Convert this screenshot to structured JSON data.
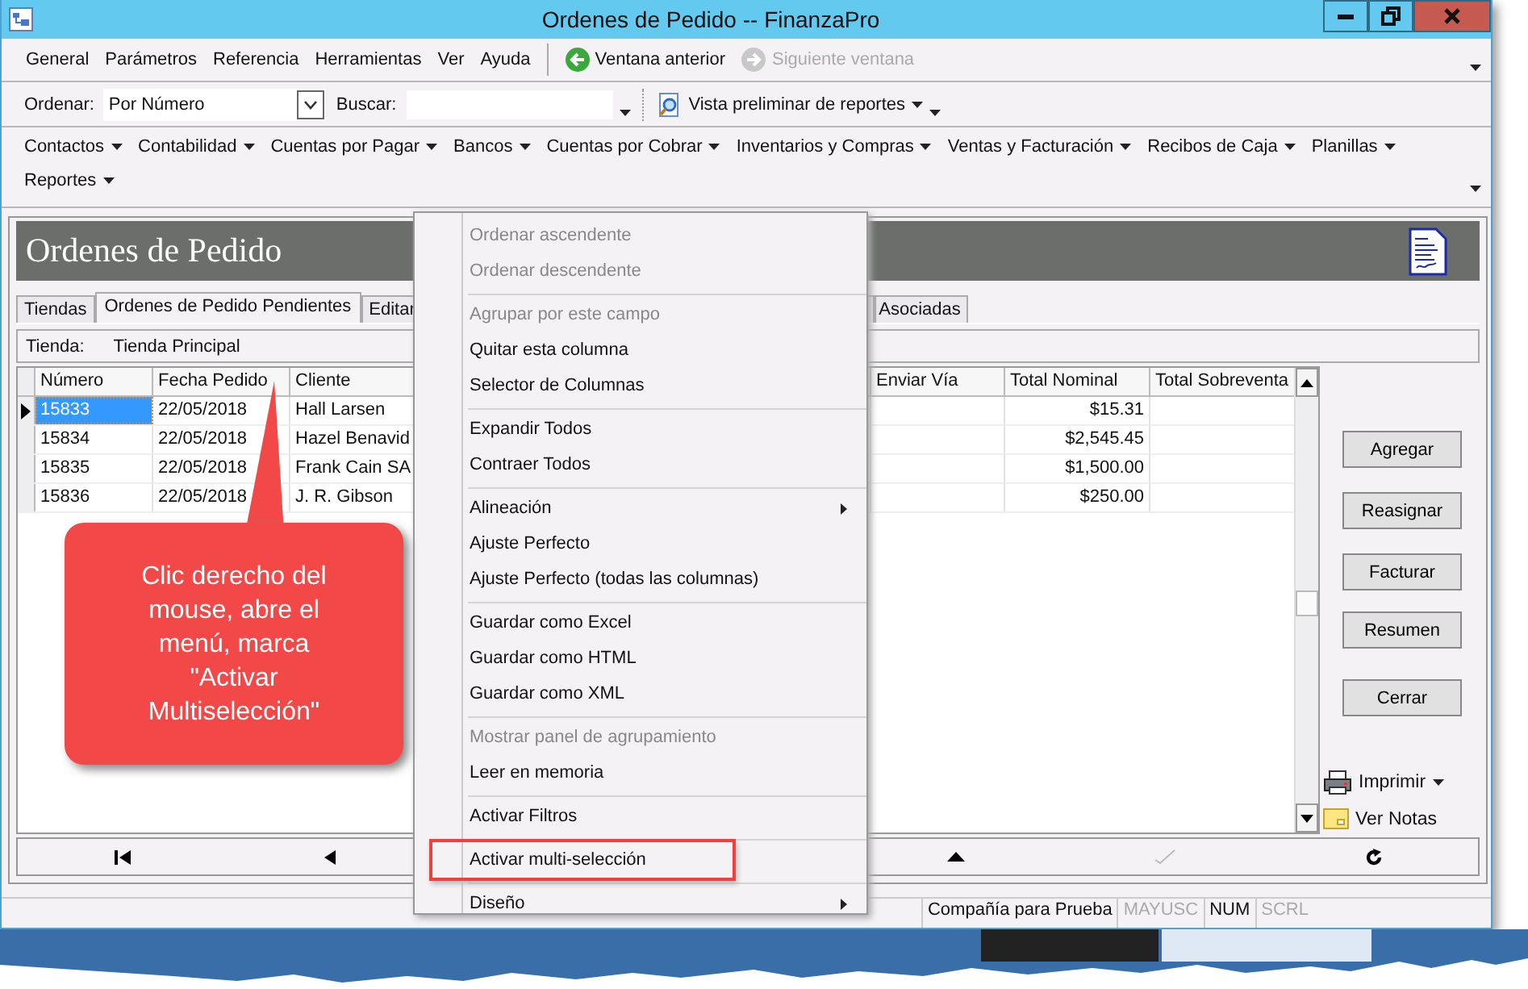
{
  "window": {
    "title": "Ordenes de Pedido -- FinanzaPro"
  },
  "menu_bar": {
    "items": [
      {
        "label": "General"
      },
      {
        "label": "Parámetros"
      },
      {
        "label": "Referencia"
      },
      {
        "label": "Herramientas"
      },
      {
        "label": "Ver"
      },
      {
        "label": "Ayuda"
      }
    ],
    "history": [
      {
        "kind": "back",
        "label": "Ventana anterior",
        "disabled": false
      },
      {
        "kind": "forward",
        "label": "Siguiente ventana",
        "disabled": true
      }
    ]
  },
  "toolbar": {
    "sort_label": "Ordenar:",
    "sort_value": "Por Número",
    "search_label": "Buscar:",
    "report_preview": "Vista preliminar de reportes"
  },
  "modules": [
    {
      "label": "Contactos"
    },
    {
      "label": "Contabilidad"
    },
    {
      "label": "Cuentas por Pagar"
    },
    {
      "label": "Bancos"
    },
    {
      "label": "Cuentas por Cobrar"
    },
    {
      "label": "Inventarios y Compras"
    },
    {
      "label": "Ventas y Facturación"
    },
    {
      "label": "Recibos de Caja"
    },
    {
      "label": "Planillas"
    },
    {
      "label": "Reportes"
    }
  ],
  "form": {
    "heading": "Ordenes de Pedido",
    "tabs": [
      {
        "label": "Tiendas",
        "selected": false
      },
      {
        "label": "Ordenes de Pedido Pendientes",
        "selected": true
      },
      {
        "label": "Editar",
        "selected": false
      },
      {
        "label": "Asociadas",
        "selected": false
      }
    ],
    "store_label": "Tienda:",
    "store_value": "Tienda Principal",
    "table": {
      "columns": [
        "Número",
        "Fecha Pedido",
        "Cliente",
        "Enviar Vía",
        "Total Nominal",
        "Total Sobreventa"
      ],
      "rows": [
        {
          "numero": "15833",
          "fecha": "22/05/2018",
          "cliente": "Hall Larsen",
          "total": "$15.31",
          "selected": true
        },
        {
          "numero": "15834",
          "fecha": "22/05/2018",
          "cliente": "Hazel Benavid",
          "total": "$2,545.45",
          "selected": false
        },
        {
          "numero": "15835",
          "fecha": "22/05/2018",
          "cliente": "Frank Cain SA",
          "total": "$1,500.00",
          "selected": false
        },
        {
          "numero": "15836",
          "fecha": "22/05/2018",
          "cliente": "J. R. Gibson",
          "total": "$250.00",
          "selected": false
        }
      ]
    },
    "buttons": [
      "Agregar",
      "Reasignar",
      "Facturar",
      "Resumen",
      "Cerrar"
    ],
    "print": "Imprimir",
    "notes": "Ver Notas"
  },
  "status_bar": {
    "company": "Compañía para Prueba",
    "keys": [
      {
        "label": "MAYUSC",
        "on": false
      },
      {
        "label": "NUM",
        "on": true
      },
      {
        "label": "SCRL",
        "on": false
      }
    ]
  },
  "context_menu": {
    "groups": [
      [
        {
          "label": "Ordenar ascendente",
          "disabled": true,
          "submenu": false,
          "marked": false
        },
        {
          "label": "Ordenar descendente",
          "disabled": true,
          "submenu": false,
          "marked": false
        }
      ],
      [
        {
          "label": "Agrupar por este campo",
          "disabled": true,
          "submenu": false,
          "marked": false
        },
        {
          "label": "Quitar esta columna",
          "disabled": false,
          "submenu": false,
          "marked": false
        },
        {
          "label": "Selector de Columnas",
          "disabled": false,
          "submenu": false,
          "marked": false
        }
      ],
      [
        {
          "label": "Expandir Todos",
          "disabled": false,
          "submenu": false,
          "marked": false
        },
        {
          "label": "Contraer Todos",
          "disabled": false,
          "submenu": false,
          "marked": false
        }
      ],
      [
        {
          "label": "Alineación",
          "disabled": false,
          "submenu": true,
          "marked": false
        },
        {
          "label": "Ajuste Perfecto",
          "disabled": false,
          "submenu": false,
          "marked": false
        },
        {
          "label": "Ajuste Perfecto (todas las columnas)",
          "disabled": false,
          "submenu": false,
          "marked": false
        }
      ],
      [
        {
          "label": "Guardar como Excel",
          "disabled": false,
          "submenu": false,
          "marked": false
        },
        {
          "label": "Guardar como HTML",
          "disabled": false,
          "submenu": false,
          "marked": false
        },
        {
          "label": "Guardar como XML",
          "disabled": false,
          "submenu": false,
          "marked": false
        }
      ],
      [
        {
          "label": "Mostrar panel de agrupamiento",
          "disabled": true,
          "submenu": false,
          "marked": false
        },
        {
          "label": "Leer en memoria",
          "disabled": false,
          "submenu": false,
          "marked": false
        }
      ],
      [
        {
          "label": "Activar Filtros",
          "disabled": false,
          "submenu": false,
          "marked": false
        }
      ],
      [
        {
          "label": "Activar multi-selección",
          "disabled": false,
          "submenu": false,
          "marked": true
        }
      ],
      [
        {
          "label": "Diseño",
          "disabled": false,
          "submenu": true,
          "marked": false
        }
      ]
    ]
  },
  "callout": {
    "text": "Clic derecho del mouse, abre el menú, marca \"Activar Multiselección\""
  }
}
